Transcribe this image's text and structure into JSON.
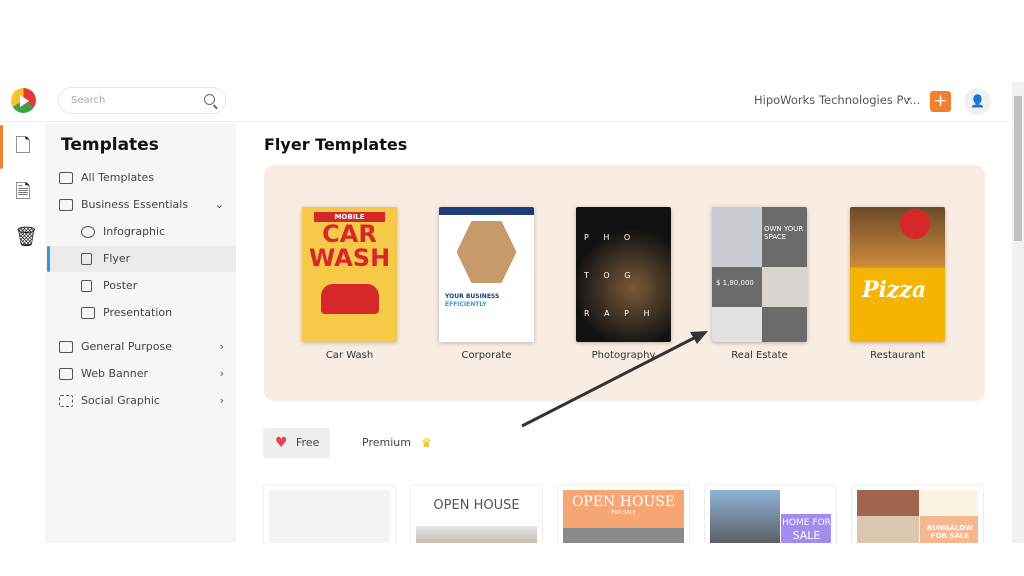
{
  "header": {
    "search_placeholder": "Search",
    "org_name": "HipoWorks Technologies Pv...",
    "add_label": "+"
  },
  "sidebar": {
    "title": "Templates",
    "items": [
      {
        "label": "All Templates",
        "icon": "layout-icon"
      },
      {
        "label": "Business Essentials",
        "icon": "building-icon",
        "expanded": true
      },
      {
        "label": "Infographic",
        "icon": "chart-pie-icon"
      },
      {
        "label": "Flyer",
        "icon": "flyer-icon",
        "selected": true
      },
      {
        "label": "Poster",
        "icon": "poster-icon"
      },
      {
        "label": "Presentation",
        "icon": "presentation-icon"
      },
      {
        "label": "General Purpose",
        "icon": "list-icon"
      },
      {
        "label": "Web Banner",
        "icon": "banner-icon"
      },
      {
        "label": "Social Graphic",
        "icon": "social-icon"
      }
    ]
  },
  "main": {
    "title": "Flyer Templates",
    "categories": [
      {
        "label": "Car Wash",
        "thumb": {
          "line1": "MOBILE",
          "line2": "CAR",
          "line3": "WASH"
        }
      },
      {
        "label": "Corporate",
        "thumb": {
          "line1": "YOUR BUSINESS",
          "line2": "EFFICIENTLY"
        }
      },
      {
        "label": "Photography",
        "thumb": {
          "line1": "P H O",
          "line2": "T O G",
          "line3": "R A P H Y"
        }
      },
      {
        "label": "Real Estate",
        "thumb": {
          "line1": "OWN YOUR SPACE",
          "line2": "$ 1,80,000"
        }
      },
      {
        "label": "Restaurant",
        "thumb": {
          "line1": "Pizza"
        }
      }
    ],
    "filters": [
      {
        "label": "Free",
        "icon": "heart-icon",
        "active": true
      },
      {
        "label": "Premium",
        "icon": "crown-icon"
      }
    ],
    "templates": [
      {
        "title": ""
      },
      {
        "title": "OPEN HOUSE"
      },
      {
        "title": "OPEN HOUSE",
        "subtitle": "FOR SALE"
      },
      {
        "title": "HOME FOR",
        "subtitle": "SALE"
      },
      {
        "title": "BUNGALOW",
        "subtitle": "FOR SALE"
      }
    ]
  },
  "colors": {
    "accent": "#f07f2e",
    "selected": "#2a9fd8",
    "panel": "#f9ece3"
  }
}
